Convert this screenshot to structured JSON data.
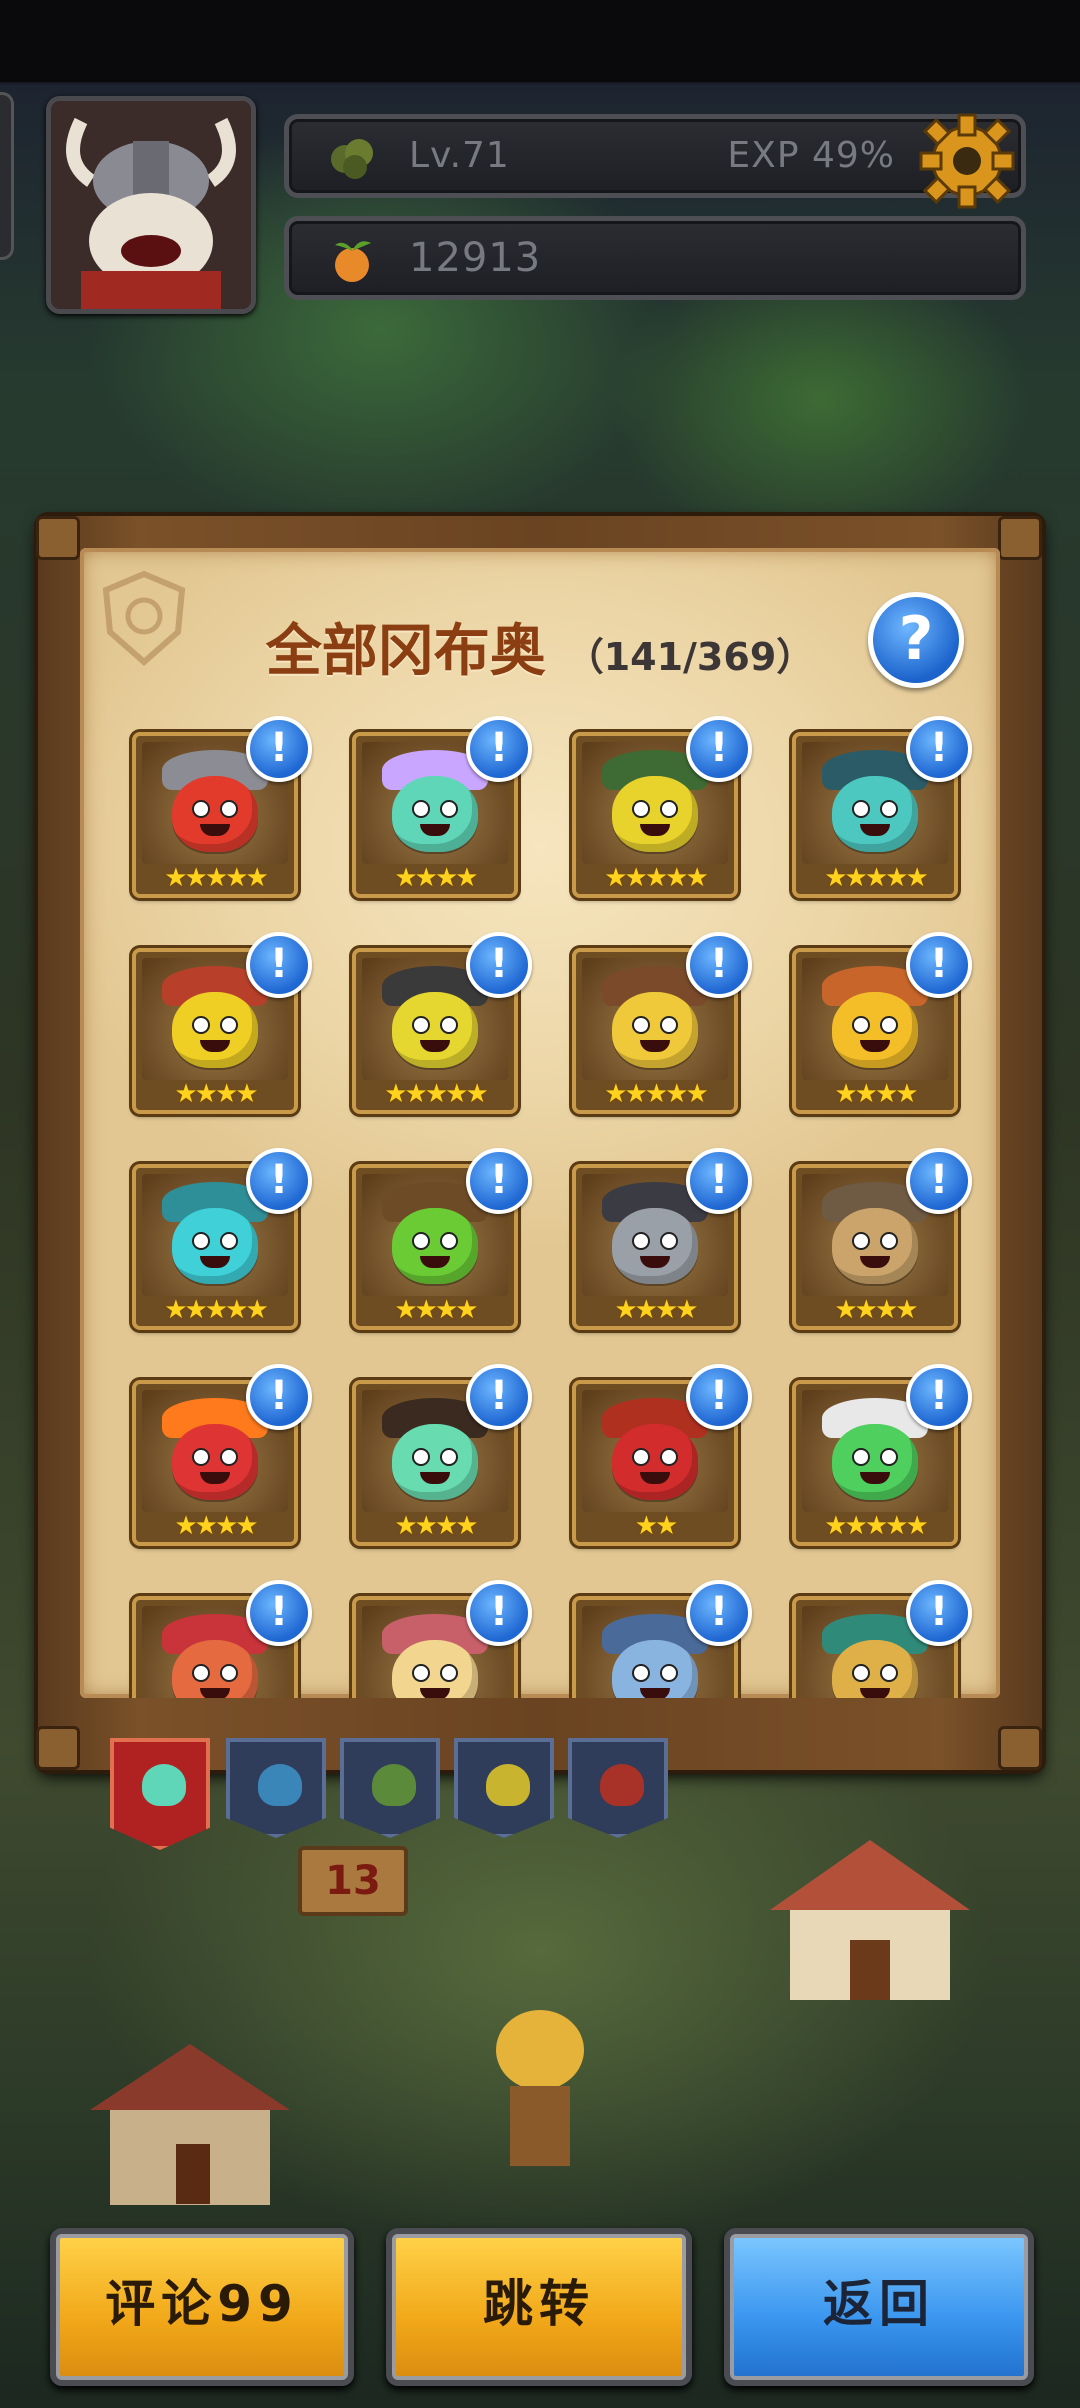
{
  "header": {
    "level_label": "Lv.71",
    "exp_label": "EXP 49%",
    "coins": "12913",
    "icons": [
      "bush-icon",
      "fruit-coin-icon",
      "gear-icon",
      "avatar-viking-icon"
    ]
  },
  "panel": {
    "title": "全部冈布奥",
    "count": "（141/369）",
    "help_label": "?"
  },
  "creatures": [
    {
      "name": "knight-red",
      "color": "#e23b2c",
      "hat": "#8c8c94",
      "stars": "★★★★★"
    },
    {
      "name": "priest-teal",
      "color": "#5fd6b8",
      "hat": "#c9a6ff",
      "stars": "★★★★"
    },
    {
      "name": "witch-yellow",
      "color": "#e8d22c",
      "hat": "#3d6b33",
      "stars": "★★★★★"
    },
    {
      "name": "pirate-teal",
      "color": "#4cc8c0",
      "hat": "#2b5b66",
      "stars": "★★★★★"
    },
    {
      "name": "gladiator-yellow",
      "color": "#f0cf25",
      "hat": "#b8402a",
      "stars": "★★★★"
    },
    {
      "name": "viking-yellow",
      "color": "#e5d630",
      "hat": "#3a3a3a",
      "stars": "★★★★★"
    },
    {
      "name": "cowboy-yellow",
      "color": "#efc93a",
      "hat": "#7a4a2a",
      "stars": "★★★★★"
    },
    {
      "name": "miner-yellow",
      "color": "#f3be28",
      "hat": "#c8652a",
      "stars": "★★★★"
    },
    {
      "name": "alchemist-cyan",
      "color": "#3fd0d8",
      "hat": "#2f8f98",
      "stars": "★★★★★"
    },
    {
      "name": "druid-green",
      "color": "#6acb35",
      "hat": "#6e4b27",
      "stars": "★★★★"
    },
    {
      "name": "vampire-gray",
      "color": "#9aa0a8",
      "hat": "#3b3b44",
      "stars": "★★★★"
    },
    {
      "name": "steam-tan",
      "color": "#caa46a",
      "hat": "#6f5a44",
      "stars": "★★★★"
    },
    {
      "name": "demon-red",
      "color": "#de3434",
      "hat": "#ff7a1c",
      "stars": "★★★★"
    },
    {
      "name": "gentleman-mint",
      "color": "#68dbb0",
      "hat": "#3a2a20",
      "stars": "★★★★"
    },
    {
      "name": "dragon-red",
      "color": "#d22c2c",
      "hat": "#b03020",
      "stars": "★★"
    },
    {
      "name": "cloud-green",
      "color": "#4fcf5d",
      "hat": "#e8e8e8",
      "stars": "★★★★★"
    },
    {
      "name": "curly-red",
      "color": "#e56a40",
      "hat": "#c8343a",
      "stars": ""
    },
    {
      "name": "mushroom-cream",
      "color": "#f2d58e",
      "hat": "#c8606a",
      "stars": ""
    },
    {
      "name": "ice-king",
      "color": "#8ab4e0",
      "hat": "#4a6a9a",
      "stars": ""
    },
    {
      "name": "forest-teal",
      "color": "#e0b048",
      "hat": "#2f8a7a",
      "stars": ""
    }
  ],
  "info_label": "!",
  "tabs": [
    {
      "name": "tab-all",
      "color": "#5fd6b8"
    },
    {
      "name": "tab-blue",
      "color": "#3a86b8"
    },
    {
      "name": "tab-green",
      "color": "#5b8a3a"
    },
    {
      "name": "tab-yellow",
      "color": "#c9b430"
    },
    {
      "name": "tab-red",
      "color": "#a83228"
    }
  ],
  "village": {
    "signpost": "13"
  },
  "buttons": {
    "comment": "评论99",
    "jump": "跳转",
    "back": "返回"
  }
}
